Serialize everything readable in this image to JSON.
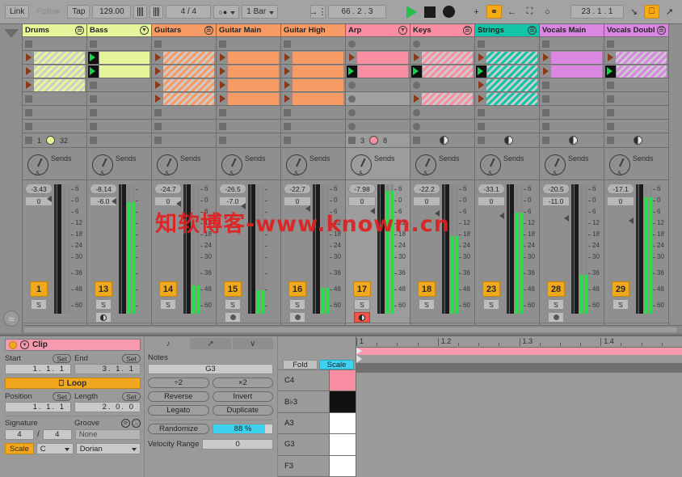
{
  "toolbar": {
    "link": "Link",
    "follow": "Follow",
    "tap": "Tap",
    "tempo": "129.00",
    "time_signature": "4 / 4",
    "metronome_value": "",
    "quantize": "1 Bar",
    "arrangement_position": "66 .  2 .  3",
    "loop_position": "23 .  1 .  1",
    "play_label": "play",
    "stop_label": "stop",
    "record_label": "record",
    "accent_yellow": "#f5aa16",
    "play_green": "#24c24a"
  },
  "tracks": [
    {
      "name": "Drums",
      "color": "#e4f59a",
      "icon": "list-icon",
      "selected": false,
      "volume": "-3.43",
      "pan": "0",
      "number": "1",
      "solo": "S",
      "rec_style": "solo-only",
      "meter": 0,
      "scene_status": {
        "left": "1",
        "right": "32",
        "pie_color": "#e4f59a"
      },
      "slots": [
        {
          "state": "stop"
        },
        {
          "state": "clip",
          "color": "#e4f59a",
          "hatched": true,
          "playing": false
        },
        {
          "state": "clip",
          "color": "#e4f59a",
          "hatched": true,
          "playing": false
        },
        {
          "state": "clip",
          "color": "#e4f59a",
          "hatched": true,
          "playing": false
        },
        {
          "state": "stop"
        },
        {
          "state": "stop"
        },
        {
          "state": "stop"
        }
      ]
    },
    {
      "name": "Bass",
      "color": "#e4f59a",
      "icon": "chevron-down-icon",
      "selected": false,
      "volume": "-8.14",
      "pan": "-6.0",
      "number": "13",
      "solo": "S",
      "rec_style": "half",
      "meter": 86,
      "scene_status": {
        "left": "",
        "right": "",
        "pie_color": ""
      },
      "slots": [
        {
          "state": "stop"
        },
        {
          "state": "clip",
          "color": "#e4f59a",
          "hatched": false,
          "playing": true
        },
        {
          "state": "clip",
          "color": "#e4f59a",
          "hatched": false,
          "playing": true
        },
        {
          "state": "stop"
        },
        {
          "state": "stop"
        },
        {
          "state": "stop"
        },
        {
          "state": "stop"
        }
      ]
    },
    {
      "name": "Guitars",
      "color": "#f79b66",
      "icon": "list-icon",
      "selected": false,
      "volume": "-24.7",
      "pan": "0",
      "number": "14",
      "solo": "S",
      "rec_style": "solo-only",
      "meter": 22,
      "scene_status": {
        "left": "",
        "right": "",
        "pie_color": ""
      },
      "slots": [
        {
          "state": "stop"
        },
        {
          "state": "clip",
          "color": "#f79b66",
          "hatched": true,
          "playing": false
        },
        {
          "state": "clip",
          "color": "#f79b66",
          "hatched": true,
          "playing": false
        },
        {
          "state": "clip",
          "color": "#f79b66",
          "hatched": true,
          "playing": false
        },
        {
          "state": "clip",
          "color": "#f79b66",
          "hatched": true,
          "playing": false
        },
        {
          "state": "stop"
        },
        {
          "state": "stop"
        }
      ]
    },
    {
      "name": "Guitar Main",
      "color": "#f79b66",
      "icon": "",
      "selected": false,
      "volume": "-26.5",
      "pan": "-7.0",
      "number": "15",
      "solo": "S",
      "rec_style": "dot",
      "meter": 18,
      "scene_status": {
        "left": "",
        "right": "",
        "pie_color": ""
      },
      "slots": [
        {
          "state": "stop"
        },
        {
          "state": "clip",
          "color": "#f79b66",
          "hatched": false,
          "playing": false
        },
        {
          "state": "clip",
          "color": "#f79b66",
          "hatched": false,
          "playing": false
        },
        {
          "state": "clip",
          "color": "#f79b66",
          "hatched": false,
          "playing": false
        },
        {
          "state": "clip",
          "color": "#f79b66",
          "hatched": false,
          "playing": false
        },
        {
          "state": "stop"
        },
        {
          "state": "stop"
        }
      ]
    },
    {
      "name": "Guitar High",
      "color": "#f79b66",
      "icon": "",
      "selected": false,
      "volume": "-22.7",
      "pan": "0",
      "number": "16",
      "solo": "S",
      "rec_style": "dot",
      "meter": 20,
      "scene_status": {
        "left": "",
        "right": "",
        "pie_color": ""
      },
      "slots": [
        {
          "state": "stop"
        },
        {
          "state": "clip",
          "color": "#f79b66",
          "hatched": false,
          "playing": false
        },
        {
          "state": "clip",
          "color": "#f79b66",
          "hatched": false,
          "playing": false
        },
        {
          "state": "clip",
          "color": "#f79b66",
          "hatched": false,
          "playing": false
        },
        {
          "state": "clip",
          "color": "#f79b66",
          "hatched": false,
          "playing": false
        },
        {
          "state": "stop"
        },
        {
          "state": "stop"
        }
      ]
    },
    {
      "name": "Arp",
      "color": "#f98da1",
      "icon": "chevron-down-icon",
      "selected": true,
      "volume": "-7.98",
      "pan": "0",
      "number": "17",
      "solo": "S",
      "rec_style": "armed",
      "meter": 95,
      "scene_status": {
        "left": "3",
        "right": "8",
        "pie_color": "#f98da1"
      },
      "slots": [
        {
          "state": "stop"
        },
        {
          "state": "clip",
          "color": "#f98da1",
          "hatched": false,
          "playing": false
        },
        {
          "state": "clip",
          "color": "#f98da1",
          "hatched": false,
          "playing": true
        },
        {
          "state": "stop"
        },
        {
          "state": "stop_lite"
        },
        {
          "state": "stop"
        },
        {
          "state": "stop"
        }
      ]
    },
    {
      "name": "Keys",
      "color": "#f98da1",
      "icon": "list-icon",
      "selected": false,
      "volume": "-22.2",
      "pan": "0",
      "number": "18",
      "solo": "S",
      "rec_style": "none",
      "meter": 60,
      "scene_status": {
        "left": "",
        "right": "",
        "pie_color": "half"
      },
      "slots": [
        {
          "state": "stop"
        },
        {
          "state": "clip",
          "color": "#f98da1",
          "hatched": true,
          "playing": false
        },
        {
          "state": "clip",
          "color": "#f98da1",
          "hatched": true,
          "playing": true
        },
        {
          "state": "stop"
        },
        {
          "state": "clip",
          "color": "#f98da1",
          "hatched": true,
          "playing": false
        },
        {
          "state": "stop"
        },
        {
          "state": "stop"
        }
      ]
    },
    {
      "name": "Strings",
      "color": "#14c4a8",
      "icon": "list-icon",
      "selected": false,
      "volume": "-33.1",
      "pan": "0",
      "number": "23",
      "solo": "S",
      "rec_style": "none",
      "meter": 78,
      "scene_status": {
        "left": "",
        "right": "",
        "pie_color": "half"
      },
      "slots": [
        {
          "state": "stop"
        },
        {
          "state": "clip",
          "color": "#14c4a8",
          "hatched": true,
          "playing": false
        },
        {
          "state": "clip",
          "color": "#14c4a8",
          "hatched": true,
          "playing": true
        },
        {
          "state": "clip",
          "color": "#14c4a8",
          "hatched": true,
          "playing": false
        },
        {
          "state": "clip",
          "color": "#14c4a8",
          "hatched": true,
          "playing": false
        },
        {
          "state": "stop"
        },
        {
          "state": "stop"
        }
      ]
    },
    {
      "name": "Vocals Main",
      "color": "#d987e0",
      "icon": "",
      "selected": false,
      "volume": "-20.5",
      "pan": "-11.0",
      "number": "28",
      "solo": "S",
      "rec_style": "dot",
      "meter": 30,
      "scene_status": {
        "left": "",
        "right": "",
        "pie_color": "half"
      },
      "slots": [
        {
          "state": "stop"
        },
        {
          "state": "clip",
          "color": "#d987e0",
          "hatched": false,
          "playing": false
        },
        {
          "state": "clip",
          "color": "#d987e0",
          "hatched": false,
          "playing": false
        },
        {
          "state": "stop"
        },
        {
          "state": "stop"
        },
        {
          "state": "stop"
        },
        {
          "state": "stop"
        }
      ]
    },
    {
      "name": "Vocals Doubl",
      "color": "#d987e0",
      "icon": "list-icon",
      "selected": false,
      "volume": "-17.1",
      "pan": "0",
      "number": "29",
      "solo": "S",
      "rec_style": "none",
      "meter": 90,
      "scene_status": {
        "left": "",
        "right": "",
        "pie_color": "half"
      },
      "slots": [
        {
          "state": "stop"
        },
        {
          "state": "clip",
          "color": "#d987e0",
          "hatched": true,
          "playing": false
        },
        {
          "state": "clip",
          "color": "#d987e0",
          "hatched": true,
          "playing": true
        },
        {
          "state": "stop"
        },
        {
          "state": "stop"
        },
        {
          "state": "stop"
        },
        {
          "state": "stop"
        }
      ]
    }
  ],
  "sends_label": "Sends",
  "meter_scale": [
    "6",
    "0",
    "6",
    "12",
    "18",
    "24",
    "30",
    "36",
    "48",
    "60"
  ],
  "clip_panel": {
    "title": "Clip",
    "start_label": "Start",
    "end_label": "End",
    "set_label": "Set",
    "start_value": "1.  1.  1",
    "end_value": "3.  1.  1",
    "loop_label": "Loop",
    "position_label": "Position",
    "length_label": "Length",
    "position_value": "1.  1.  1",
    "length_value": "2.  0.  0",
    "signature_label": "Signature",
    "groove_label": "Groove",
    "sig_numerator": "4",
    "sig_denominator": "4",
    "sig_slash": "/",
    "groove_value": "None",
    "scale_label": "Scale",
    "scale_root": "C",
    "scale_mode": "Dorian"
  },
  "notes_panel": {
    "tab_notes_icon": "music-note-icon",
    "tab_envelopes_icon": "envelope-line-icon",
    "tab_expression_icon": "expression-icon",
    "notes_label": "Notes",
    "notes_value": "G3",
    "half_label": "÷2",
    "double_label": "×2",
    "reverse_label": "Reverse",
    "invert_label": "Invert",
    "legato_label": "Legato",
    "duplicate_label": "Duplicate",
    "randomize_label": "Randomize",
    "randomize_value": "88 %",
    "randomize_percent": 88,
    "velocity_range_label": "Velocity Range",
    "velocity_range_value": "0"
  },
  "piano_roll": {
    "fold_label": "Fold",
    "scale_label": "Scale",
    "key_names": [
      "C4",
      "B♭3",
      "A3",
      "G3",
      "F3"
    ],
    "key_colors": [
      "#f98da1",
      "#111111",
      "#ffffff",
      "#ffffff",
      "#ffffff"
    ],
    "ruler_marks": [
      "1",
      "1.2",
      "1.3",
      "1.4"
    ],
    "notes": [
      {
        "label": "G3",
        "row": 3,
        "left_pct": 5.0,
        "width_pct": 6.2,
        "selected": true
      },
      {
        "label": "F3",
        "row": 4,
        "left_pct": 28.0,
        "width_pct": 6.2,
        "selected": false
      },
      {
        "label": "B♭3",
        "row": 1,
        "left_pct": 38.5,
        "width_pct": 6.2,
        "selected": false
      },
      {
        "label": "G3",
        "row": 3,
        "left_pct": 61.5,
        "width_pct": 6.2,
        "selected": false
      },
      {
        "label": "G3",
        "row": 3,
        "left_pct": 83.0,
        "width_pct": 6.2,
        "selected": false
      }
    ]
  },
  "watermark": "知软博客-www.known.cn"
}
